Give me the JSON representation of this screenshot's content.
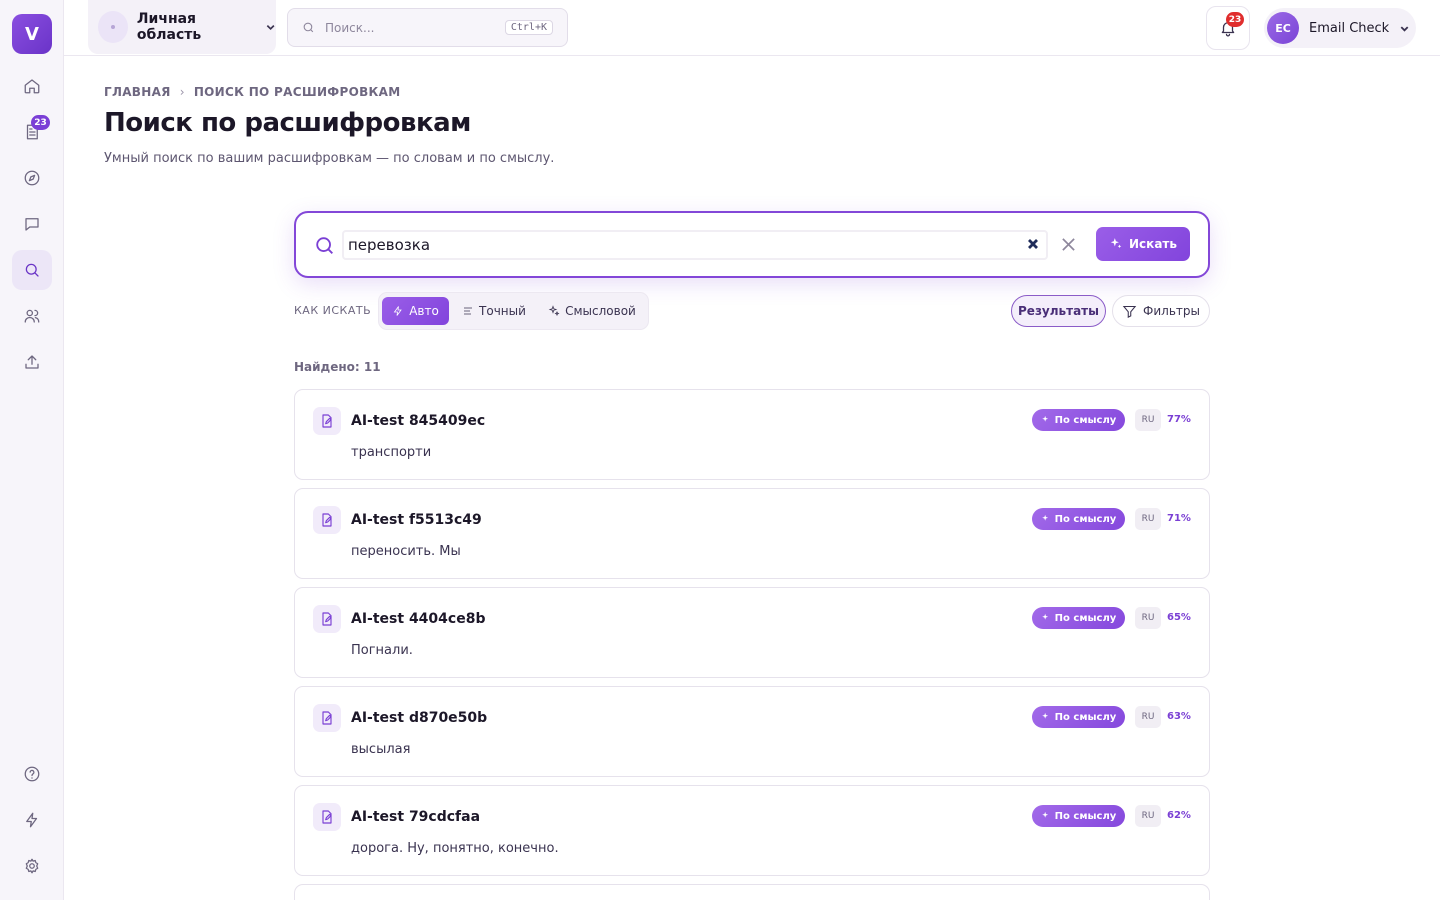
{
  "sidebar": {
    "logo": "V",
    "transcripts_badge": "23"
  },
  "topbar": {
    "workspace": "Личная область",
    "search_placeholder": "Поиск...",
    "search_shortcut": "Ctrl+K",
    "notifications_count": "23",
    "user_initials": "EC",
    "user_name": "Email Check"
  },
  "breadcrumb": {
    "home": "ГЛАВНАЯ",
    "separator": "›",
    "current": "ПОИСК ПО РАСШИФРОВКАМ"
  },
  "page": {
    "title": "Поиск по расшифровкам",
    "subtitle": "Умный поиск по вашим расшифровкам — по словам и по смыслу."
  },
  "search": {
    "query": "перевозка",
    "button": "Искать"
  },
  "modes": {
    "label": "КАК ИСКАТЬ",
    "auto": "Авто",
    "exact": "Точный",
    "semantic": "Смысловой"
  },
  "toolbar": {
    "results": "Результаты",
    "filters": "Фильтры"
  },
  "results": {
    "found": "Найдено: 11",
    "items": [
      {
        "title": "AI-test 845409ec",
        "snippet": "транспорти",
        "tag": "По смыслу",
        "lang": "RU",
        "score": "77%"
      },
      {
        "title": "AI-test f5513c49",
        "snippet": "переносить. Мы",
        "tag": "По смыслу",
        "lang": "RU",
        "score": "71%"
      },
      {
        "title": "AI-test 4404ce8b",
        "snippet": "Погнали.",
        "tag": "По смыслу",
        "lang": "RU",
        "score": "65%"
      },
      {
        "title": "AI-test d870e50b",
        "snippet": "высылая",
        "tag": "По смыслу",
        "lang": "RU",
        "score": "63%"
      },
      {
        "title": "AI-test 79cdcfaa",
        "snippet": "дорога. Ну, понятно, конечно.",
        "tag": "По смыслу",
        "lang": "RU",
        "score": "62%"
      }
    ]
  }
}
